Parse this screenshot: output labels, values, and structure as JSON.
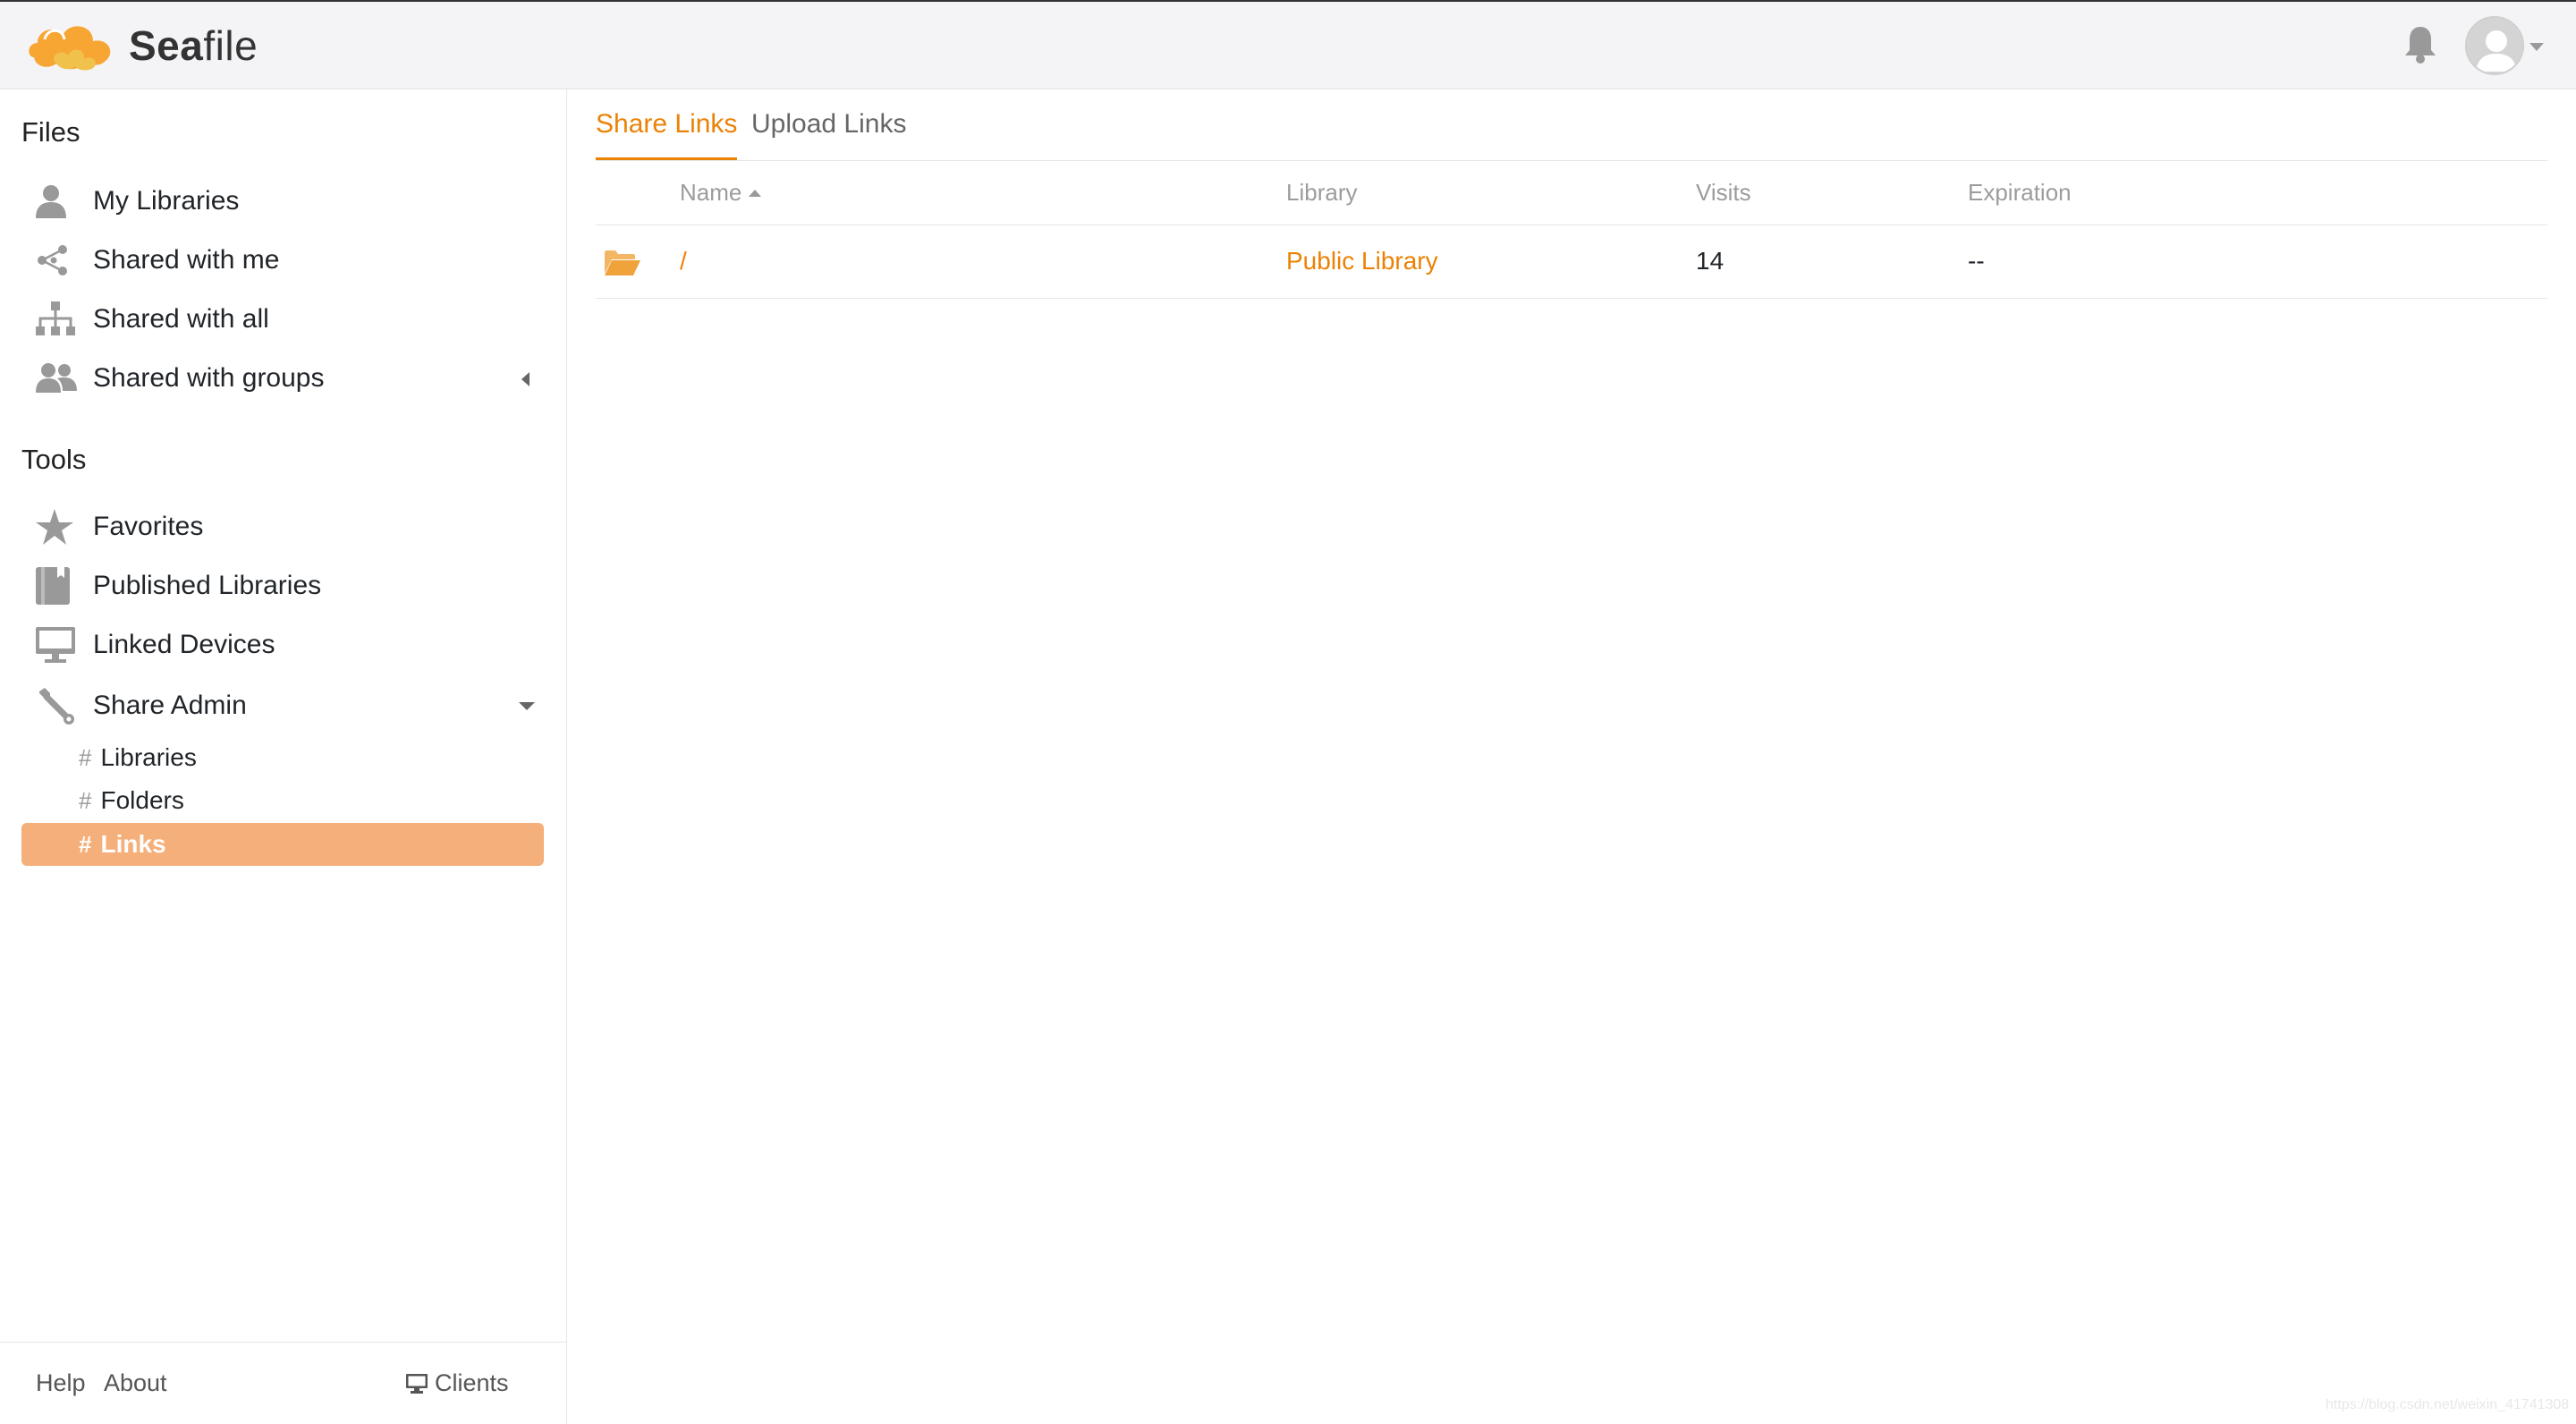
{
  "header": {
    "logo_text_bold": "Sea",
    "logo_text_rest": "file"
  },
  "sidebar": {
    "files_heading": "Files",
    "files_items": [
      {
        "label": "My Libraries",
        "icon": "user-icon"
      },
      {
        "label": "Shared with me",
        "icon": "share-icon"
      },
      {
        "label": "Shared with all",
        "icon": "sitemap-icon"
      },
      {
        "label": "Shared with groups",
        "icon": "group-icon"
      }
    ],
    "tools_heading": "Tools",
    "tools_items": [
      {
        "label": "Favorites",
        "icon": "star-icon"
      },
      {
        "label": "Published Libraries",
        "icon": "book-icon"
      },
      {
        "label": "Linked Devices",
        "icon": "monitor-icon"
      },
      {
        "label": "Share Admin",
        "icon": "wrench-icon"
      }
    ],
    "share_admin_sub": [
      {
        "hash": "#",
        "label": "Libraries"
      },
      {
        "hash": "#",
        "label": "Folders"
      },
      {
        "hash": "#",
        "label": "Links",
        "active": true
      }
    ],
    "footer": {
      "help": "Help",
      "about": "About",
      "clients": "Clients"
    }
  },
  "main": {
    "tabs": [
      {
        "label": "Share Links",
        "active": true
      },
      {
        "label": "Upload Links",
        "active": false
      }
    ],
    "table": {
      "columns": {
        "name": "Name",
        "library": "Library",
        "visits": "Visits",
        "expiration": "Expiration"
      },
      "rows": [
        {
          "name": "/",
          "library": "Public Library",
          "visits": "14",
          "expiration": "--"
        }
      ]
    }
  },
  "colors": {
    "accent": "#eb8205",
    "active_item_bg": "#f5af7a",
    "header_bg": "#f4f4f7"
  },
  "watermark": "https://blog.csdn.net/weixin_41741308"
}
